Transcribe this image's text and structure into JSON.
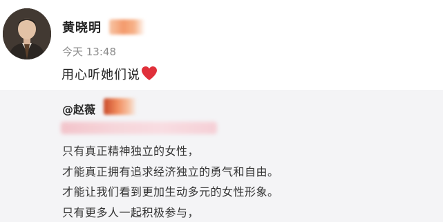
{
  "post": {
    "author_name": "黄晓明",
    "timestamp": "今天 13:48",
    "text": "用心听她们说",
    "heart_color": "#e0303a"
  },
  "repost": {
    "mention": "@赵薇",
    "lines": [
      "只有真正精神独立的女性，",
      "才能真正拥有追求经济独立的勇气和自由。",
      "才能让我们看到更加生动多元的女性形象。",
      "只有更多人一起积极参与，"
    ]
  }
}
